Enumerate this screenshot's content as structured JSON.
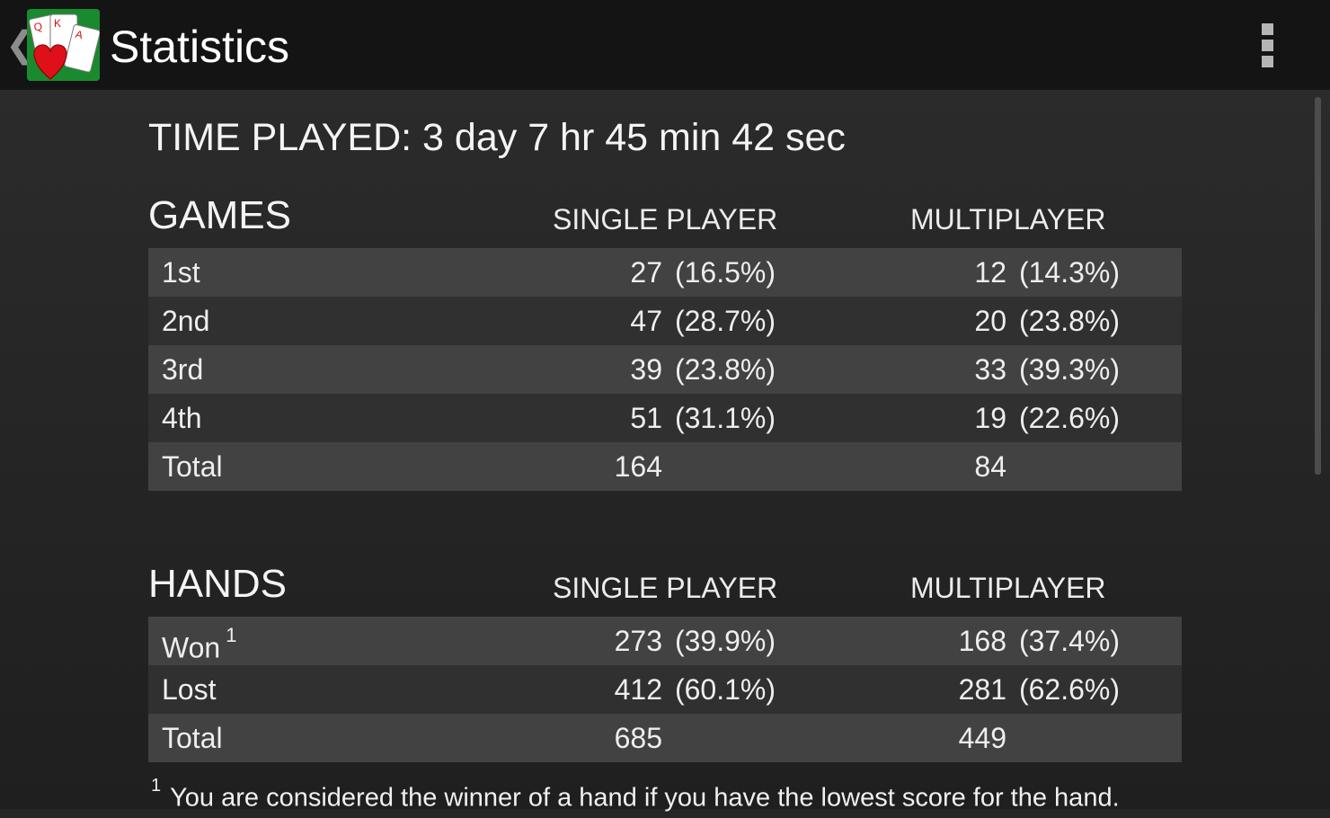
{
  "actionbar": {
    "title": "Statistics",
    "back_icon": "chevron-left-icon",
    "app_icon": "hearts-cards-icon",
    "menu_icon": "overflow-menu-icon"
  },
  "time_played": "TIME PLAYED: 3 day 7 hr 45 min 42 sec",
  "games": {
    "title": "GAMES",
    "col_single": "SINGLE PLAYER",
    "col_multi": "MULTIPLAYER",
    "rows": [
      {
        "label": "1st",
        "sp_num": "27",
        "sp_pct": "(16.5%)",
        "mp_num": "12",
        "mp_pct": "(14.3%)"
      },
      {
        "label": "2nd",
        "sp_num": "47",
        "sp_pct": "(28.7%)",
        "mp_num": "20",
        "mp_pct": "(23.8%)"
      },
      {
        "label": "3rd",
        "sp_num": "39",
        "sp_pct": "(23.8%)",
        "mp_num": "33",
        "mp_pct": "(39.3%)"
      },
      {
        "label": "4th",
        "sp_num": "51",
        "sp_pct": "(31.1%)",
        "mp_num": "19",
        "mp_pct": "(22.6%)"
      },
      {
        "label": "Total",
        "sp_num": "164",
        "sp_pct": "",
        "mp_num": "84",
        "mp_pct": ""
      }
    ]
  },
  "hands": {
    "title": "HANDS",
    "col_single": "SINGLE PLAYER",
    "col_multi": "MULTIPLAYER",
    "rows": [
      {
        "label": "Won",
        "note": "1",
        "sp_num": "273",
        "sp_pct": "(39.9%)",
        "mp_num": "168",
        "mp_pct": "(37.4%)"
      },
      {
        "label": "Lost",
        "note": "",
        "sp_num": "412",
        "sp_pct": "(60.1%)",
        "mp_num": "281",
        "mp_pct": "(62.6%)"
      },
      {
        "label": "Total",
        "note": "",
        "sp_num": "685",
        "sp_pct": "",
        "mp_num": "449",
        "mp_pct": ""
      }
    ]
  },
  "footnote": {
    "marker": "1",
    "text": "You are considered the winner of a hand if you have the lowest score for the hand."
  },
  "colors": {
    "actionbar": "#141414",
    "background": "#262626",
    "row_light": "#424242",
    "row_dark": "#303030",
    "icon_green": "#1a8a2e",
    "heart_red": "#e0101a"
  }
}
